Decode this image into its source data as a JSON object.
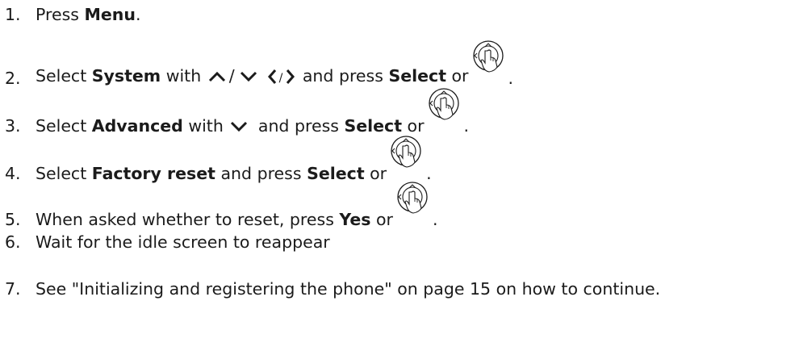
{
  "steps": [
    {
      "number": "1.",
      "t1": "Press ",
      "b1": "Menu",
      "t2": "."
    },
    {
      "number": "2.",
      "t1": "Select ",
      "b1": "System",
      "t2": " with ",
      "slash1": "/",
      "slash2": "/",
      "t3": " and press ",
      "b2": "Select",
      "t4": " or ",
      "end": "."
    },
    {
      "number": "3.",
      "t1": "Select ",
      "b1": "Advanced",
      "t2": " with ",
      "t3": " and press ",
      "b2": "Select",
      "t4": " or ",
      "end": "."
    },
    {
      "number": "4.",
      "t1": "Select ",
      "b1": "Factory reset",
      "t2": " and press ",
      "b2": "Select",
      "t3": " or ",
      "end": "."
    },
    {
      "number": "5.",
      "t1": "When asked whether to reset, press ",
      "b1": "Yes",
      "t2": " or ",
      "end": "."
    },
    {
      "number": "6.",
      "t1": "Wait for the idle screen to reappear"
    },
    {
      "number": "7.",
      "t1": "See \"Initializing and registering the phone\" on page 15 on how to continue."
    }
  ],
  "icons": {
    "up": "chevron-up-icon",
    "down": "chevron-down-icon",
    "left": "chevron-left-icon",
    "right": "chevron-right-icon",
    "navkey": "navigation-key-press-icon"
  }
}
